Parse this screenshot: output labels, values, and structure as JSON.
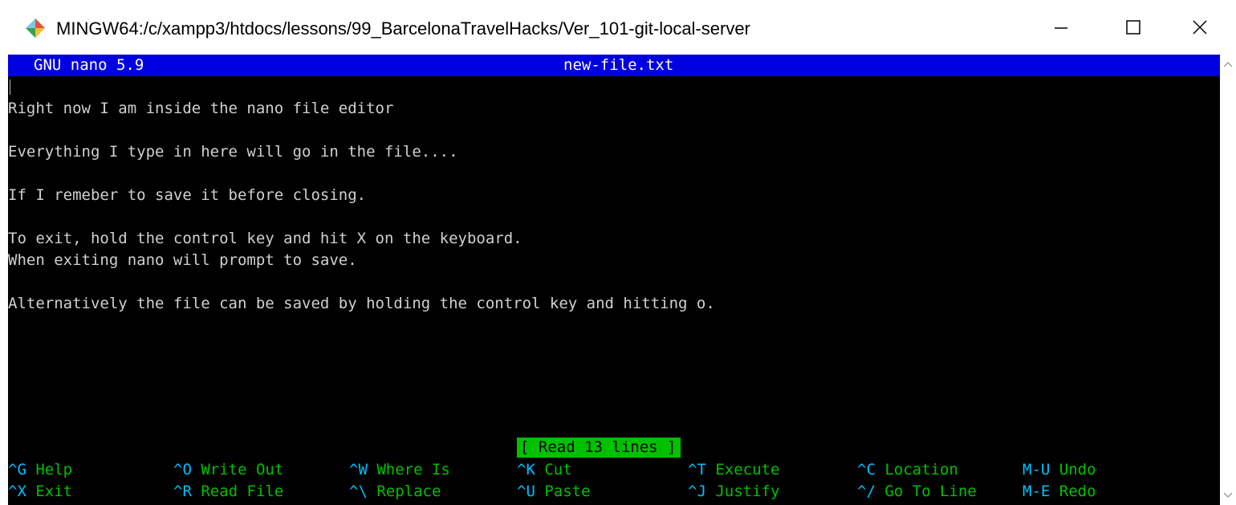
{
  "window": {
    "title": "MINGW64:/c/xampp3/htdocs/lessons/99_BarcelonaTravelHacks/Ver_101-git-local-server",
    "icon": "git-bash-icon",
    "controls": [
      "minimize-icon",
      "maximize-icon",
      "close-icon"
    ]
  },
  "nano": {
    "version": "GNU nano 5.9",
    "filename": "new-file.txt",
    "lines": [
      "",
      "Right now I am inside the nano file editor",
      "",
      "Everything I type in here will go in the file....",
      "",
      "If I remeber to save it before closing.",
      "",
      "To exit, hold the control key and hit X on the keyboard.",
      "When exiting nano will prompt to save.",
      "",
      "Alternatively the file can be saved by holding the control key and hitting o."
    ],
    "status": "[ Read 13 lines ]",
    "shortcuts_row1": [
      {
        "key": "^G",
        "label": "Help"
      },
      {
        "key": "^O",
        "label": "Write Out"
      },
      {
        "key": "^W",
        "label": "Where Is"
      },
      {
        "key": "^K",
        "label": "Cut"
      },
      {
        "key": "^T",
        "label": "Execute"
      },
      {
        "key": "^C",
        "label": "Location"
      },
      {
        "key": "M-U",
        "label": "Undo"
      }
    ],
    "shortcuts_row2": [
      {
        "key": "^X",
        "label": "Exit"
      },
      {
        "key": "^R",
        "label": "Read File"
      },
      {
        "key": "^\\",
        "label": "Replace"
      },
      {
        "key": "^U",
        "label": "Paste"
      },
      {
        "key": "^J",
        "label": "Justify"
      },
      {
        "key": "^/",
        "label": "Go To Line"
      },
      {
        "key": "M-E",
        "label": "Redo"
      }
    ]
  },
  "colors": {
    "header_bg": "#0000e0",
    "terminal_bg": "#000000",
    "text": "#d0d0d0",
    "status_bg": "#00c000",
    "shortcut_key": "#00c0ff",
    "shortcut_label": "#00c000"
  }
}
